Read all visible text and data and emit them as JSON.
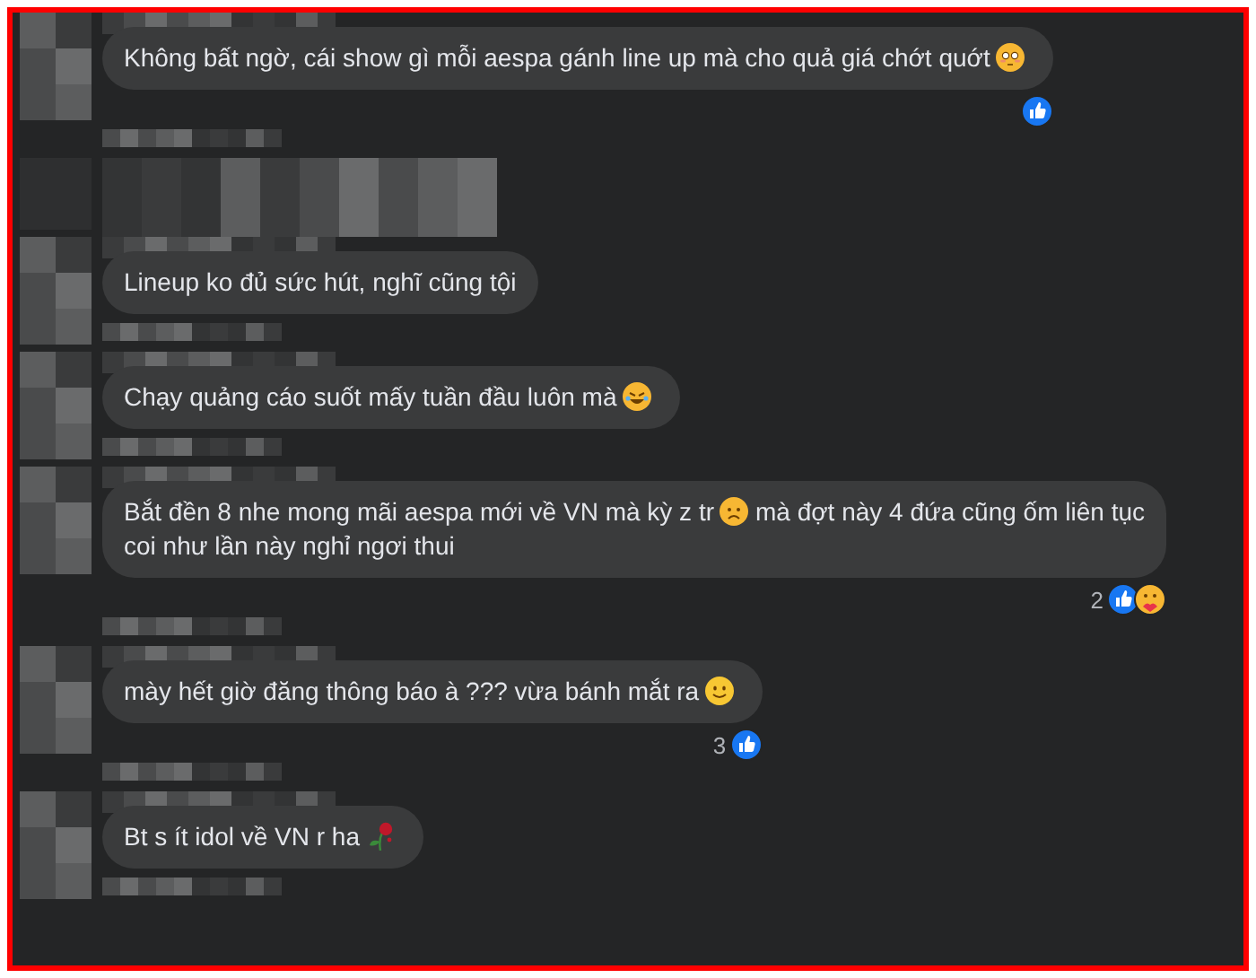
{
  "comments": [
    {
      "kind": "text",
      "parts": [
        {
          "kind": "text",
          "text": "Không bất ngờ, cái show gì mỗi aespa gánh line up mà cho quả giá chớt quớt"
        },
        {
          "kind": "flushed"
        }
      ],
      "reactions": [
        {
          "kind": "like"
        }
      ]
    },
    {
      "kind": "blurred"
    },
    {
      "kind": "text",
      "parts": [
        {
          "kind": "text",
          "text": "Lineup ko đủ sức hút, nghĩ cũng tội"
        }
      ]
    },
    {
      "kind": "text",
      "parts": [
        {
          "kind": "text",
          "text": "Chạy quảng cáo suốt mấy tuần đầu luôn mà"
        },
        {
          "kind": "rofl"
        }
      ]
    },
    {
      "kind": "text",
      "parts": [
        {
          "kind": "text",
          "text": "Bắt đền 8 nhe mong mãi aespa mới về VN mà kỳ z tr"
        },
        {
          "kind": "sad"
        },
        {
          "kind": "text",
          "text": "mà đợt này 4 đứa cũng ốm liên tục"
        },
        {
          "kind": "break"
        },
        {
          "kind": "text",
          "text": "coi như lần này nghỉ ngơi thui"
        }
      ],
      "reaction_count": "2",
      "reactions": [
        {
          "kind": "like"
        },
        {
          "kind": "care"
        }
      ]
    },
    {
      "kind": "text",
      "parts": [
        {
          "kind": "text",
          "text": "mày hết giờ đăng thông báo à ??? vừa bánh mắt ra"
        },
        {
          "kind": "smile"
        }
      ],
      "reaction_count": "3",
      "reactions": [
        {
          "kind": "like"
        }
      ]
    },
    {
      "kind": "text",
      "parts": [
        {
          "kind": "text",
          "text": "Bt s ít idol về VN r ha"
        },
        {
          "kind": "rose"
        }
      ]
    }
  ]
}
